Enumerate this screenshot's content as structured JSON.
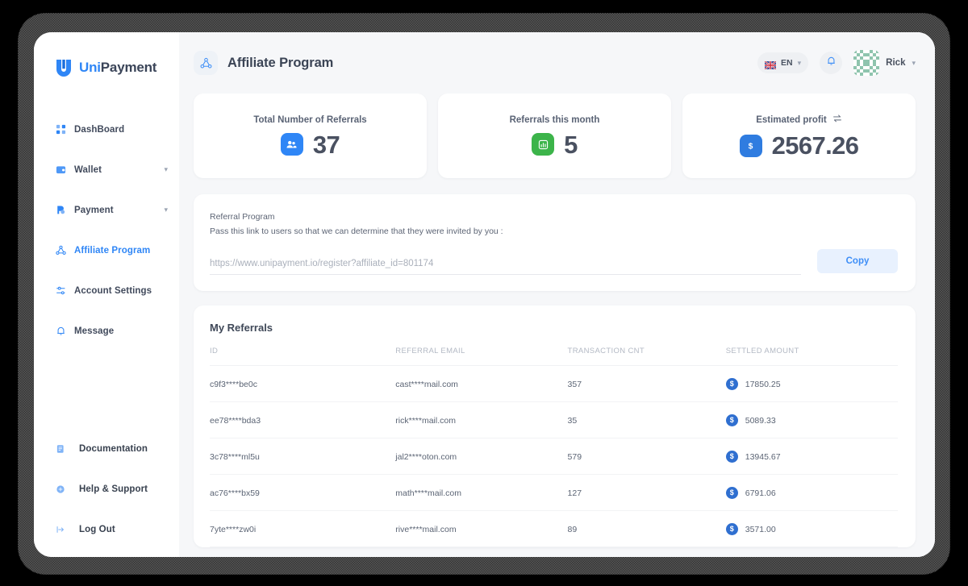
{
  "brand": {
    "part1": "Uni",
    "part2": "Payment"
  },
  "sidebar": {
    "items": [
      {
        "label": "DashBoard",
        "icon": "grid-icon",
        "expandable": false,
        "active": false
      },
      {
        "label": "Wallet",
        "icon": "wallet-icon",
        "expandable": true,
        "active": false
      },
      {
        "label": "Payment",
        "icon": "payment-icon",
        "expandable": true,
        "active": false
      },
      {
        "label": "Affiliate Program",
        "icon": "affiliate-icon",
        "expandable": false,
        "active": true
      },
      {
        "label": "Account Settings",
        "icon": "settings-sliders-icon",
        "expandable": false,
        "active": false
      },
      {
        "label": "Message",
        "icon": "bell-icon",
        "expandable": false,
        "active": false
      }
    ],
    "bottom_items": [
      {
        "label": "Documentation",
        "icon": "document-icon"
      },
      {
        "label": "Help & Support",
        "icon": "help-circle-icon"
      },
      {
        "label": "Log Out",
        "icon": "logout-icon"
      }
    ]
  },
  "header": {
    "title": "Affiliate Program",
    "page_icon": "affiliate-icon",
    "language": "EN",
    "language_flag": "uk-flag-icon",
    "notification_icon": "bell-icon",
    "user_name": "Rick",
    "avatar": "identicon-avatar"
  },
  "stats": [
    {
      "title": "Total Number of Referrals",
      "value": "37",
      "badge_icon": "users-icon",
      "badge_color": "#2f86f6",
      "has_swap": false
    },
    {
      "title": "Referrals this month",
      "value": "5",
      "badge_icon": "bar-chart-icon",
      "badge_color": "#3cb44a",
      "has_swap": false
    },
    {
      "title": "Estimated profit",
      "value": "2567.26",
      "badge_icon": "dollar-icon",
      "badge_color": "#2f7ce0",
      "has_swap": true,
      "swap_icon": "swap-arrows-icon"
    }
  ],
  "referral": {
    "title": "Referral Program",
    "subtitle": "Pass this link to users so that we can determine that they were invited by you :",
    "link_value": "https://www.unipayment.io/register?affiliate_id=801174",
    "link_placeholder": "https://www.unipayment.io/register?affiliate_id=801174",
    "copy_label": "Copy"
  },
  "table": {
    "title": "My Referrals",
    "columns": [
      "ID",
      "REFERRAL EMAIL",
      "TRANSACTION CNT",
      "SETTLED AMOUNT"
    ],
    "rows": [
      {
        "id": "c9f3****be0c",
        "email": "cast****mail.com",
        "cnt": "357",
        "amount": "17850.25",
        "coin_icon": "dollar-coin-icon"
      },
      {
        "id": "ee78****bda3",
        "email": "rick****mail.com",
        "cnt": "35",
        "amount": "5089.33",
        "coin_icon": "dollar-coin-icon"
      },
      {
        "id": "3c78****ml5u",
        "email": "jal2****oton.com",
        "cnt": "579",
        "amount": "13945.67",
        "coin_icon": "dollar-coin-icon"
      },
      {
        "id": "ac76****bx59",
        "email": "math****mail.com",
        "cnt": "127",
        "amount": "6791.06",
        "coin_icon": "dollar-coin-icon"
      },
      {
        "id": "7yte****zw0i",
        "email": "rive****mail.com",
        "cnt": "89",
        "amount": "3571.00",
        "coin_icon": "dollar-coin-icon"
      }
    ],
    "pager": {
      "prev_label": "",
      "next_label": ""
    }
  },
  "colors": {
    "accent": "#2f86f6",
    "green": "#3cb44a",
    "coin_blue": "#2f6fd0",
    "text_dark": "#3b4455",
    "text_muted": "#b3b9c4",
    "page_bg": "#f6f7f9"
  }
}
